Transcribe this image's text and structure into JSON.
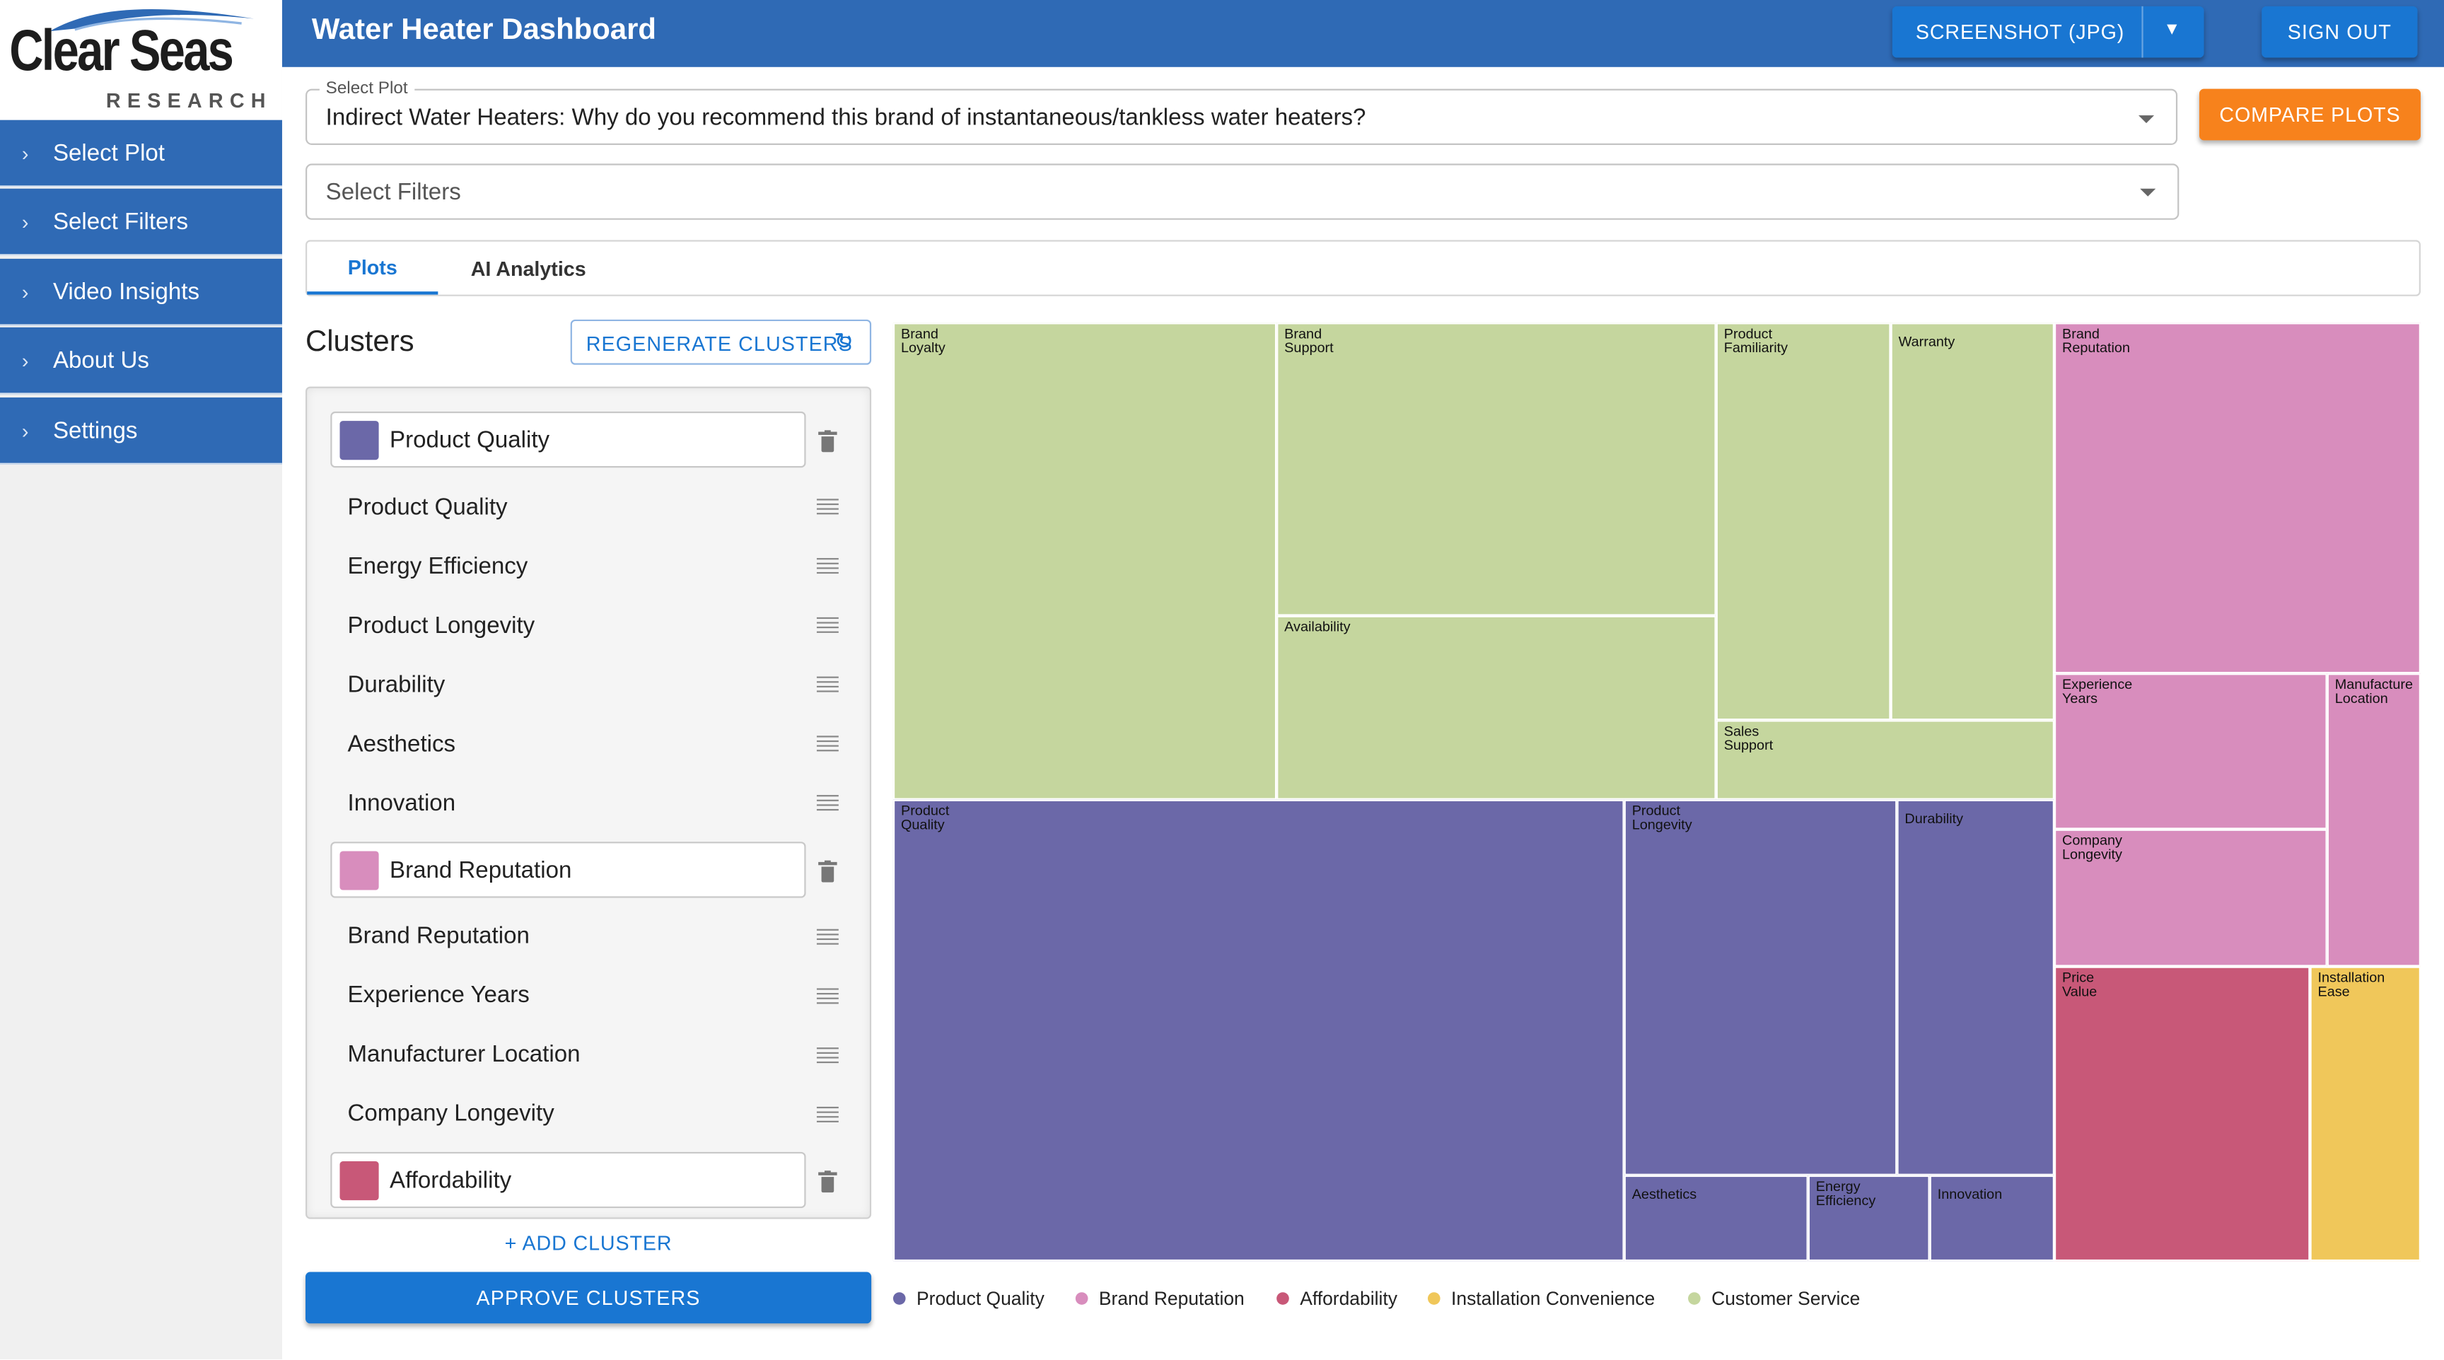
{
  "brand": {
    "logo_line1": "Clear Seas",
    "logo_line2": "RESEARCH"
  },
  "sidebar": {
    "items": [
      {
        "label": "Select Plot"
      },
      {
        "label": "Select Filters"
      },
      {
        "label": "Video Insights"
      },
      {
        "label": "About Us"
      },
      {
        "label": "Settings"
      }
    ]
  },
  "header": {
    "title": "Water Heater Dashboard",
    "screenshot_label": "SCREENSHOT (JPG)",
    "sign_out_label": "SIGN OUT"
  },
  "select_plot": {
    "legend": "Select Plot",
    "value": "Indirect Water Heaters: Why do you recommend this brand of instantaneous/tankless water heaters?"
  },
  "select_filters": {
    "placeholder": "Select Filters"
  },
  "compare_label": "COMPARE PLOTS",
  "tabs": [
    {
      "label": "Plots"
    },
    {
      "label": "AI Analytics"
    }
  ],
  "clusters": {
    "title": "Clusters",
    "regenerate_label": "REGENERATE CLUSTERS",
    "add_label": "+ ADD CLUSTER",
    "approve_label": "APPROVE CLUSTERS",
    "groups": [
      {
        "name": "Product Quality",
        "color": "#6b68a8",
        "items": [
          "Product Quality",
          "Energy Efficiency",
          "Product Longevity",
          "Durability",
          "Aesthetics",
          "Innovation"
        ]
      },
      {
        "name": "Brand Reputation",
        "color": "#d88dbd",
        "items": [
          "Brand Reputation",
          "Experience Years",
          "Manufacturer Location",
          "Company Longevity"
        ]
      },
      {
        "name": "Affordability",
        "color": "#c85878",
        "items": []
      }
    ]
  },
  "chart_data": {
    "type": "treemap",
    "groups": [
      {
        "name": "Customer Service",
        "color": "#c5d69e",
        "leaves": [
          "Brand\nLoyalty",
          "Brand\nSupport",
          "Availability",
          "Product\nFamiliarity",
          "Warranty",
          "Sales\nSupport"
        ]
      },
      {
        "name": "Product Quality",
        "color": "#6b68a8",
        "leaves": [
          "Product\nQuality",
          "Product\nLongevity",
          "Durability",
          "Aesthetics",
          "Energy\nEfficiency",
          "Innovation"
        ]
      },
      {
        "name": "Brand Reputation",
        "color": "#d88dbd",
        "leaves": [
          "Brand\nReputation",
          "Experience\nYears",
          "Manufacture\nLocation",
          "Company\nLongevity"
        ]
      },
      {
        "name": "Affordability",
        "color": "#c85878",
        "leaves": [
          "Price\nValue"
        ]
      },
      {
        "name": "Installation Convenience",
        "color": "#f0c75a",
        "leaves": [
          "Installation\nEase"
        ]
      }
    ],
    "legend": [
      {
        "name": "Product Quality",
        "color": "#6b68a8"
      },
      {
        "name": "Brand Reputation",
        "color": "#d88dbd"
      },
      {
        "name": "Affordability",
        "color": "#c85878"
      },
      {
        "name": "Installation Convenience",
        "color": "#f0c75a"
      },
      {
        "name": "Customer Service",
        "color": "#c5d69e"
      }
    ]
  }
}
